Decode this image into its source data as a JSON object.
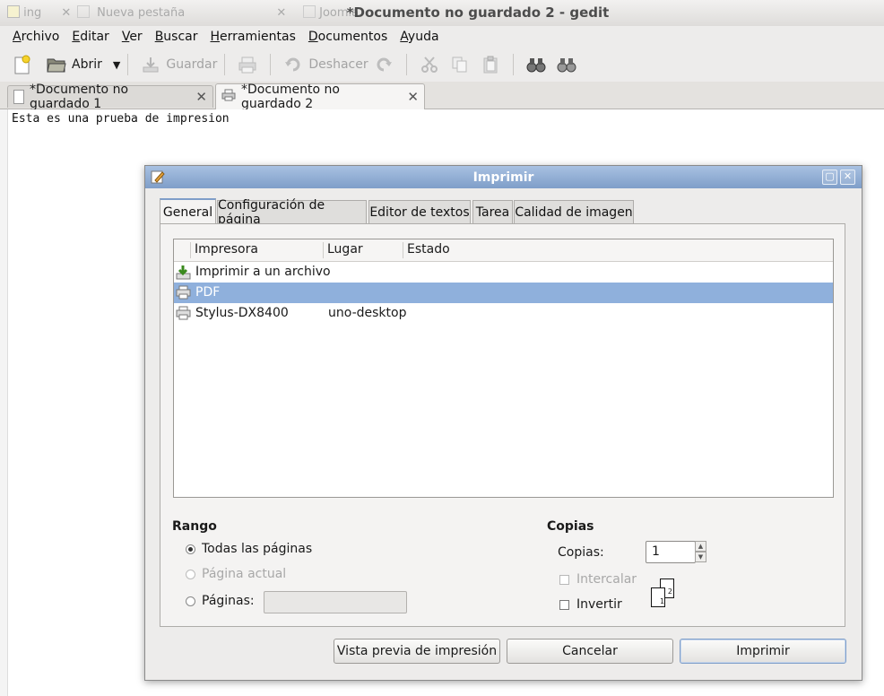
{
  "window": {
    "title": "*Documento no guardado 2 - gedit",
    "background_tabs": [
      "ing",
      "Nueva pestaña",
      "Joomla"
    ]
  },
  "menubar": {
    "items": [
      {
        "label": "Archivo",
        "accel": "A",
        "rest": "rchivo"
      },
      {
        "label": "Editar",
        "accel": "E",
        "rest": "ditar"
      },
      {
        "label": "Ver",
        "accel": "V",
        "rest": "er"
      },
      {
        "label": "Buscar",
        "accel": "B",
        "rest": "uscar"
      },
      {
        "label": "Herramientas",
        "accel": "H",
        "rest": "erramientas"
      },
      {
        "label": "Documentos",
        "accel": "D",
        "rest": "ocumentos"
      },
      {
        "label": "Ayuda",
        "accel": "A",
        "rest": "yuda"
      }
    ]
  },
  "toolbar": {
    "open_label": "Abrir",
    "save_label": "Guardar",
    "undo_label": "Deshacer"
  },
  "tabs": [
    {
      "label": "*Documento no guardado 1",
      "active": false
    },
    {
      "label": "*Documento no guardado 2",
      "active": true
    }
  ],
  "editor": {
    "text": "Esta es una prueba de impresion"
  },
  "print_dialog": {
    "title": "Imprimir",
    "tabs": [
      "General",
      "Configuración de página",
      "Editor de textos",
      "Tarea",
      "Calidad de imagen"
    ],
    "active_tab": "General",
    "columns": [
      "Impresora",
      "Lugar",
      "Estado"
    ],
    "printers": [
      {
        "name": "Imprimir a un archivo",
        "location": "",
        "status": "",
        "icon": "file-save-icon"
      },
      {
        "name": "PDF",
        "location": "",
        "status": "",
        "icon": "printer-icon",
        "selected": true
      },
      {
        "name": "Stylus-DX8400",
        "location": "uno-desktop",
        "status": "",
        "icon": "printer-icon"
      }
    ],
    "range": {
      "title": "Rango",
      "all_pages": "Todas las páginas",
      "current_page": "Página actual",
      "pages": "Páginas:",
      "pages_value": "",
      "selected": "all_pages"
    },
    "copies": {
      "title": "Copias",
      "label": "Copias:",
      "value": "1",
      "collate": "Intercalar",
      "reverse": "Invertir",
      "collate_checked": false,
      "reverse_checked": false
    },
    "buttons": {
      "preview": "Vista previa de impresión",
      "cancel": "Cancelar",
      "print": "Imprimir"
    }
  },
  "colors": {
    "selection": "#8fb0dc",
    "dialog_title": "#7f9ec9"
  }
}
